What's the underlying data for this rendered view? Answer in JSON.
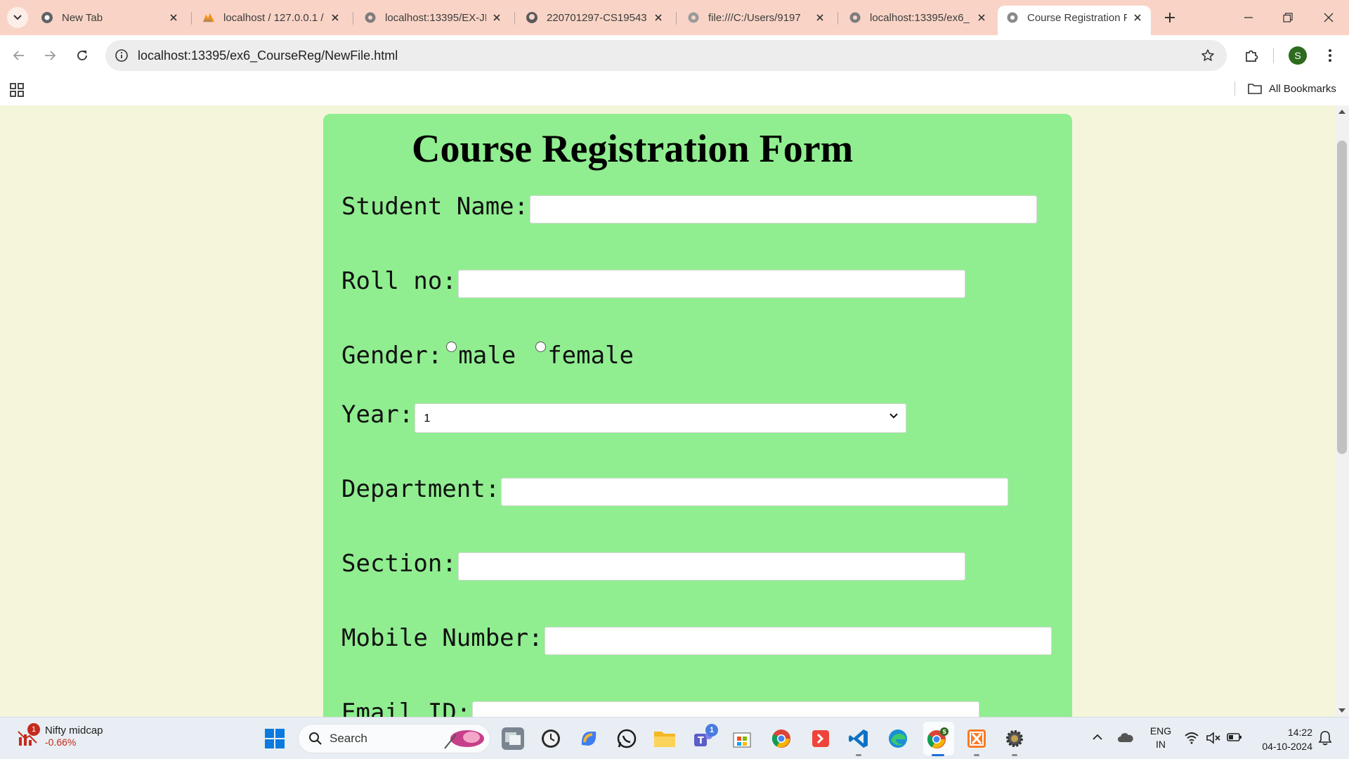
{
  "browser": {
    "tabs": [
      {
        "title": "New Tab",
        "favicon": "chrome-icon",
        "active": false
      },
      {
        "title": "localhost / 127.0.0.1 /",
        "favicon": "phpmyadmin-icon",
        "active": false
      },
      {
        "title": "localhost:13395/EX-JI",
        "favicon": "globe-icon",
        "active": false
      },
      {
        "title": "220701297-CS19543",
        "favicon": "github-icon",
        "active": false
      },
      {
        "title": "file:///C:/Users/9197",
        "favicon": "globe-icon",
        "active": false
      },
      {
        "title": "localhost:13395/ex6_",
        "favicon": "globe-icon",
        "active": false
      },
      {
        "title": "Course Registration F",
        "favicon": "globe-icon",
        "active": true
      }
    ],
    "url_host": "localhost",
    "url_rest": ":13395/ex6_CourseReg/NewFile.html",
    "profile_initial": "S",
    "all_bookmarks_label": "All Bookmarks"
  },
  "form": {
    "title": "Course Registration Form",
    "student_name_label": "Student Name:",
    "roll_no_label": "Roll no:",
    "gender_label": "Gender:",
    "gender_options": [
      "male",
      "female"
    ],
    "year_label": "Year:",
    "year_value": "1",
    "department_label": "Department:",
    "section_label": "Section:",
    "mobile_label": "Mobile Number:",
    "email_label": "Email ID:"
  },
  "taskbar": {
    "ticker_name": "Nifty midcap",
    "ticker_change": "-0.66%",
    "ticker_badge": "1",
    "search_label": "Search",
    "teams_badge": "1",
    "lang_line1": "ENG",
    "lang_line2": "IN",
    "time": "14:22",
    "date": "04-10-2024"
  },
  "colors": {
    "tabstrip": "#f9d4c6",
    "page_bg": "#f5f5dc",
    "form_bg": "#90ee90",
    "ticker_negative": "#c42b1c"
  }
}
